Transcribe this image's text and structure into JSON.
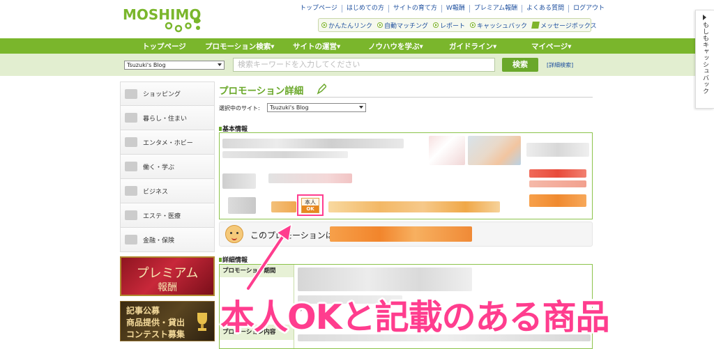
{
  "header": {
    "logo_text": "MOSHIMO",
    "top_links": [
      "トップページ",
      "はじめての方",
      "サイトの育て方",
      "W報酬",
      "プレミアム報酬",
      "よくある質問",
      "ログアウト"
    ],
    "quick_links": [
      "かんたんリンク",
      "自動マッチング",
      "レポート",
      "キャッシュバック",
      "メッセージボックス"
    ]
  },
  "nav": {
    "items": [
      "トップページ",
      "プロモーション検索▾",
      "サイトの運営▾",
      "ノウハウを学ぶ▾",
      "ガイドライン▾",
      "マイページ▾"
    ]
  },
  "search": {
    "site_selected": "Tsuzuki's Blog",
    "placeholder": "検索キーワードを入力してください",
    "button": "検索",
    "advanced": "[詳細検索]"
  },
  "side_tab": {
    "label": "もしもキャッシュバック"
  },
  "sidebar": {
    "categories": [
      {
        "label": "ショッピング",
        "icon": "cart-icon"
      },
      {
        "label": "暮らし・住まい",
        "icon": "house-icon"
      },
      {
        "label": "エンタメ・ホビー",
        "icon": "film-icon"
      },
      {
        "label": "働く・学ぶ",
        "icon": "desk-icon"
      },
      {
        "label": "ビジネス",
        "icon": "briefcase-icon"
      },
      {
        "label": "エステ・医療",
        "icon": "beauty-icon"
      },
      {
        "label": "金融・保険",
        "icon": "money-icon"
      }
    ],
    "banner_premium": {
      "line1": "プレミアム",
      "line2": "報酬"
    },
    "banner_contest": {
      "line1": "記事公募",
      "line2": "商品提供・貸出",
      "line3": "コンテスト募集"
    }
  },
  "main": {
    "title": "プロモーション詳細",
    "selected_site_label": "選択中のサイト:",
    "selected_site": "Tsuzuki's Blog",
    "basic_info_title": "基本情報",
    "badge_top": "本人",
    "badge_bottom": "OK",
    "notice_text": "このプロモーションは",
    "detail_title": "詳細情報",
    "detail_rows": [
      "プロモーション期間",
      "プロモーション内容"
    ],
    "detail_snippets": [
      "けで",
      "料"
    ]
  },
  "annotation": {
    "caption": "本人OKと記載のある商品",
    "color": "#ff3d8e"
  }
}
